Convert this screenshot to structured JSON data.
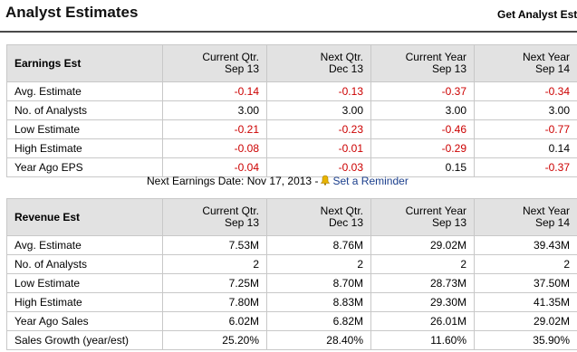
{
  "page": {
    "title": "Analyst Estimates",
    "get_link": "Get Analyst Esti"
  },
  "earnings": {
    "header": {
      "label": "Earnings Est",
      "cols": [
        {
          "line1": "Current Qtr.",
          "line2": "Sep 13"
        },
        {
          "line1": "Next Qtr.",
          "line2": "Dec 13"
        },
        {
          "line1": "Current Year",
          "line2": "Sep 13"
        },
        {
          "line1": "Next Year",
          "line2": "Sep 14"
        }
      ]
    },
    "rows": [
      {
        "label": "Avg. Estimate",
        "values": [
          "-0.14",
          "-0.13",
          "-0.37",
          "-0.34"
        ]
      },
      {
        "label": "No. of Analysts",
        "values": [
          "3.00",
          "3.00",
          "3.00",
          "3.00"
        ]
      },
      {
        "label": "Low Estimate",
        "values": [
          "-0.21",
          "-0.23",
          "-0.46",
          "-0.77"
        ]
      },
      {
        "label": "High Estimate",
        "values": [
          "-0.08",
          "-0.01",
          "-0.29",
          "0.14"
        ]
      },
      {
        "label": "Year Ago EPS",
        "values": [
          "-0.04",
          "-0.03",
          "0.15",
          "-0.37"
        ]
      }
    ]
  },
  "next_earnings": {
    "text": "Next Earnings Date: Nov 17, 2013 -",
    "reminder_label": "Set a Reminder",
    "bell_icon": "bell-icon"
  },
  "revenue": {
    "header": {
      "label": "Revenue Est",
      "cols": [
        {
          "line1": "Current Qtr.",
          "line2": "Sep 13"
        },
        {
          "line1": "Next Qtr.",
          "line2": "Dec 13"
        },
        {
          "line1": "Current Year",
          "line2": "Sep 13"
        },
        {
          "line1": "Next Year",
          "line2": "Sep 14"
        }
      ]
    },
    "rows": [
      {
        "label": "Avg. Estimate",
        "values": [
          "7.53M",
          "8.76M",
          "29.02M",
          "39.43M"
        ]
      },
      {
        "label": "No. of Analysts",
        "values": [
          "2",
          "2",
          "2",
          "2"
        ]
      },
      {
        "label": "Low Estimate",
        "values": [
          "7.25M",
          "8.70M",
          "28.73M",
          "37.50M"
        ]
      },
      {
        "label": "High Estimate",
        "values": [
          "7.80M",
          "8.83M",
          "29.30M",
          "41.35M"
        ]
      },
      {
        "label": "Year Ago Sales",
        "values": [
          "6.02M",
          "6.82M",
          "26.01M",
          "29.02M"
        ]
      },
      {
        "label": "Sales Growth (year/est)",
        "values": [
          "25.20%",
          "28.40%",
          "11.60%",
          "35.90%"
        ]
      }
    ]
  },
  "colors": {
    "negative": "#cc0000",
    "header_bg": "#e2e2e2",
    "link": "#1a3e8c"
  }
}
